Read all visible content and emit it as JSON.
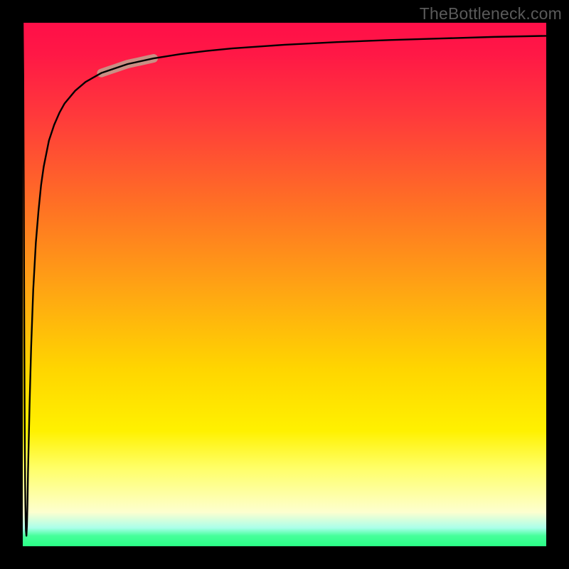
{
  "attribution": "TheBottleneck.com",
  "chart_data": {
    "type": "line",
    "title": "",
    "xlabel": "",
    "ylabel": "",
    "xlim": [
      0,
      100
    ],
    "ylim": [
      0,
      100
    ],
    "grid": false,
    "legend": false,
    "x": [
      0,
      0.1,
      0.2,
      0.25,
      0.3,
      0.35,
      0.4,
      0.45,
      0.5,
      0.55,
      0.6,
      0.7,
      0.8,
      0.9,
      1.0,
      1.3,
      1.6,
      2,
      2.5,
      3,
      3.5,
      4,
      5,
      6,
      7,
      8,
      10,
      12,
      15,
      20,
      25,
      30,
      35,
      40,
      50,
      60,
      70,
      80,
      90,
      100
    ],
    "values": [
      100,
      90,
      67,
      52,
      38,
      27,
      18,
      12,
      8,
      5,
      3,
      2,
      4,
      8,
      14,
      27,
      38,
      49,
      58,
      64,
      69,
      72.5,
      77.5,
      80.5,
      82.8,
      84.6,
      87.0,
      88.7,
      90.4,
      92.1,
      93.2,
      94.0,
      94.6,
      95.1,
      95.8,
      96.3,
      96.7,
      97.0,
      97.3,
      97.5
    ],
    "highlight": {
      "x_range": [
        15,
        25
      ],
      "color": "#c98f84",
      "width": 12
    },
    "annotations": []
  }
}
